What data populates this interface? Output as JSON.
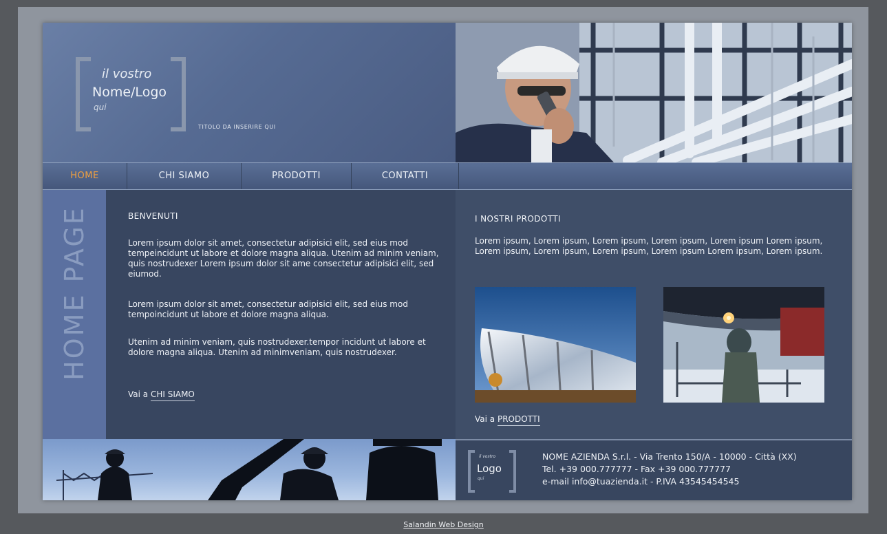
{
  "header": {
    "logo_line1": "il vostro",
    "logo_line2": "Nome/Logo",
    "logo_line3": "qui",
    "tagline": "TITOLO DA INSERIRE QUI"
  },
  "nav": {
    "items": [
      {
        "label": "HOME",
        "active": true
      },
      {
        "label": "CHI SIAMO",
        "active": false
      },
      {
        "label": "PRODOTTI",
        "active": false
      },
      {
        "label": "CONTATTI",
        "active": false
      }
    ]
  },
  "sidebar": {
    "vertical_text": "HOME PAGE"
  },
  "welcome": {
    "title": "BENVENUTI",
    "paragraphs": [
      "Lorem ipsum dolor sit amet, consectetur adipisici elit, sed eius mod tempeincidunt ut labore et dolore magna aliqua. Utenim ad minim veniam, quis nostrudexer Lorem ipsum dolor sit ame consectetur adipisici elit, sed eiumod.",
      "Lorem ipsum dolor sit amet, consectetur adipisici elit, sed eius mod tempoincidunt ut labore et dolore magna aliqua.",
      "Utenim ad minim veniam, quis nostrudexer.tempor incidunt ut labore et dolore magna aliqua. Utenim ad minimveniam, quis nostrudexer."
    ],
    "link_prefix": "Vai a ",
    "link_label": "CHI SIAMO"
  },
  "products": {
    "title": "I NOSTRI PRODOTTI",
    "text": "Lorem ipsum, Lorem ipsum, Lorem ipsum, Lorem ipsum, Lorem ipsum Lorem ipsum, Lorem ipsum, Lorem ipsum, Lorem ipsum, Lorem ipsum Lorem ipsum, Lorem ipsum.",
    "link_prefix": "Vai a ",
    "link_label": "PRODOTTI"
  },
  "footer": {
    "logo_small": "il vostro",
    "logo_big": "Logo",
    "logo_tiny": "qui",
    "line1": "NOME AZIENDA S.r.l. - Via Trento 150/A - 10000 - Città (XX)",
    "line2": "Tel. +39 000.777777 - Fax +39 000.777777",
    "line3": "e-mail info@tuazienda.it - P.IVA 43545454545"
  },
  "credit": {
    "label": "Salandin Web Design"
  },
  "colors": {
    "nav_active": "#f0a040",
    "background": "#56595d",
    "site_panel": "#3a4862"
  }
}
